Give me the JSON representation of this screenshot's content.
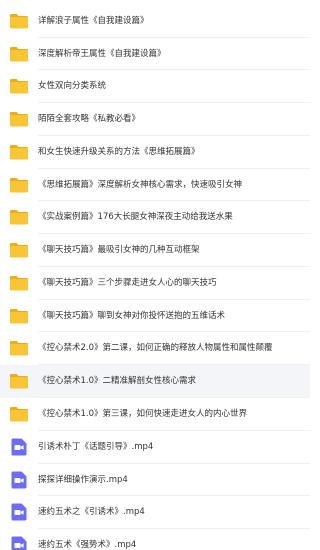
{
  "colors": {
    "folder": "#f8c537",
    "folder_dark": "#eaad1c",
    "video_bg": "#6d6cf4",
    "video_fg": "#ffffff",
    "selected_row": "#f3f5f8",
    "text": "#333333"
  },
  "rows": [
    {
      "type": "folder",
      "icon": "folder-icon",
      "name": "详解浪子属性《自我建设篇》"
    },
    {
      "type": "folder",
      "icon": "folder-icon",
      "name": "深度解析帝王属性《自我建设篇》"
    },
    {
      "type": "folder",
      "icon": "folder-icon",
      "name": "女性双向分类系统"
    },
    {
      "type": "folder",
      "icon": "folder-icon",
      "name": "陌陌全套攻略《私教必看》"
    },
    {
      "type": "folder",
      "icon": "folder-icon",
      "name": "和女生快速升级关系的方法《思维拓展篇》"
    },
    {
      "type": "folder",
      "icon": "folder-icon",
      "name": "《思维拓展篇》深度解析女神核心需求，快速吸引女神"
    },
    {
      "type": "folder",
      "icon": "folder-icon",
      "name": "《实战案例篇》176大长腿女神深夜主动给我送水果"
    },
    {
      "type": "folder",
      "icon": "folder-icon",
      "name": "《聊天技巧篇》最吸引女神的几种互动框架"
    },
    {
      "type": "folder",
      "icon": "folder-icon",
      "name": "《聊天技巧篇》三个步骤走进女人心的聊天技巧"
    },
    {
      "type": "folder",
      "icon": "folder-icon",
      "name": "《聊天技巧篇》聊到女神对你投怀送抱的五维话术"
    },
    {
      "type": "folder",
      "icon": "folder-icon",
      "name": "《控心禁术2.0》第二课，如何正确的释放人物属性和属性颠覆"
    },
    {
      "type": "folder",
      "icon": "folder-icon",
      "name": "《控心禁术1.0》二精准解剖女性核心需求",
      "selected": true
    },
    {
      "type": "folder",
      "icon": "folder-icon",
      "name": "《控心禁术1.0》第三课，如何快速走进女人的内心世界"
    },
    {
      "type": "video",
      "icon": "video-icon",
      "name": "引诱术朴丁《话题引导》.mp4"
    },
    {
      "type": "video",
      "icon": "video-icon",
      "name": "探探详细操作演示.mp4"
    },
    {
      "type": "video",
      "icon": "video-icon",
      "name": "速约五术之《引诱术》.mp4"
    },
    {
      "type": "video",
      "icon": "video-icon",
      "name": "速约五术《强势术》.mp4"
    }
  ]
}
